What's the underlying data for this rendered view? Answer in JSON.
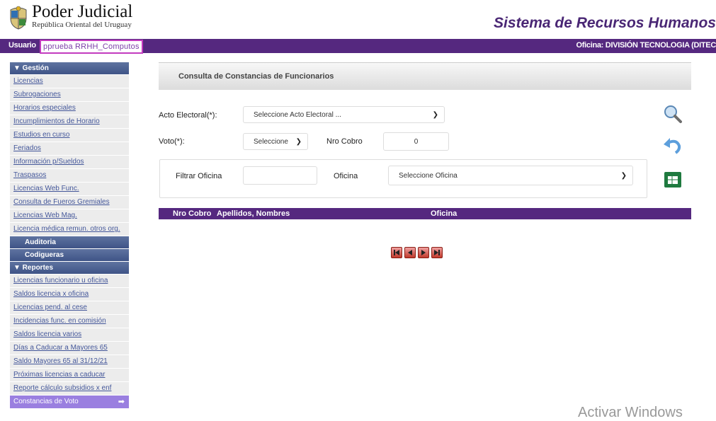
{
  "header": {
    "brand_title": "Poder Judicial",
    "brand_subtitle": "República Oriental del Uruguay",
    "system_title": "Sistema de Recursos Humanos"
  },
  "userbar": {
    "user_label": "Usuario",
    "user_name": "pprueba RRHH_Computos",
    "office": "Oficina: DIVISIÓN TECNOLOGIA (DITEC"
  },
  "sidebar": {
    "gestion_header": "▼ Gestión",
    "gestion_items": [
      "Licencias",
      "Subrogaciones",
      "Horarios especiales",
      "Incumplimientos de Horario",
      "Estudios en curso",
      "Feriados",
      "Información p/Sueldos",
      "Traspasos",
      "Licencias Web Func.",
      "Consulta de Fueros Gremiales",
      "Licencias Web Mag.",
      "Licencia médica remun. otros org."
    ],
    "auditoria": "Auditoria",
    "codigueras": "Codigueras",
    "reportes_header": "▼ Reportes",
    "reportes_items": [
      "Licencias funcionario u oficina",
      "Saldos licencia x oficina",
      "Licencias pend. al cese",
      "Incidencias func. en comisión",
      "Saldos licencia varios",
      "Días a Caducar a Mayores 65",
      "Saldo Mayores 65 al 31/12/21",
      "Próximas licencias a caducar",
      "Reporte cálculo subsidios x enf"
    ],
    "active_item": "Constancias de Voto"
  },
  "main": {
    "panel_title": "Consulta de Constancias de Funcionarios",
    "acto_label": "Acto Electoral(*):",
    "acto_value": "Seleccione Acto Electoral ...",
    "voto_label": "Voto(*):",
    "voto_value": "Seleccione",
    "nro_cobro_label": "Nro Cobro",
    "nro_cobro_value": "0",
    "filtrar_label": "Filtrar Oficina",
    "filtrar_value": "",
    "oficina_label": "Oficina",
    "oficina_value": "Seleccione Oficina"
  },
  "table": {
    "columns": [
      "Nro Cobro",
      "Apellidos, Nombres",
      "Oficina"
    ]
  },
  "watermark": "Activar Windows",
  "colors": {
    "brand_purple": "#55287f",
    "menu_header": "#4a5e90",
    "active_item": "#9a7fe0"
  }
}
